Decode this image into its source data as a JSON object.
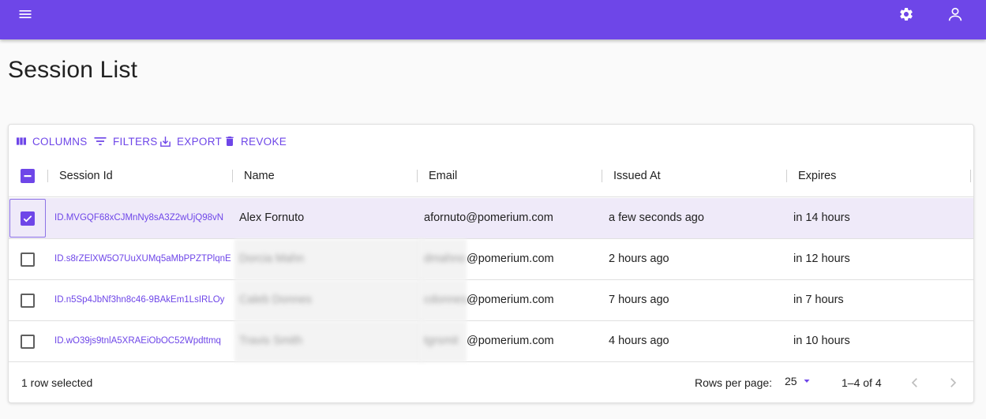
{
  "page": {
    "title": "Session List"
  },
  "toolbar": {
    "columns_label": "COLUMNS",
    "filters_label": "FILTERS",
    "export_label": "EXPORT",
    "revoke_label": "REVOKE"
  },
  "table": {
    "headers": [
      "Session Id",
      "Name",
      "Email",
      "Issued At",
      "Expires"
    ],
    "rows": [
      {
        "selected": true,
        "session_id": "ID.MVGQF68xCJMnNy8sA3Z2wUjQ98vN",
        "name": "Alex Fornuto",
        "email_user": "afornuto",
        "email_domain": "@pomerium.com",
        "email_full": "afornuto@pomerium.com",
        "issued_at": "a few seconds ago",
        "expires": "in 14 hours"
      },
      {
        "selected": false,
        "session_id": "ID.s8rZElXW5O7UuXUMq5aMbPPZTPlqnE",
        "name": "Dorcia Mahn",
        "email_user": "dmahno",
        "email_domain": "@pomerium.com",
        "issued_at": "2 hours ago",
        "expires": "in 12 hours"
      },
      {
        "selected": false,
        "session_id": "ID.n5Sp4JbNf3hn8c46-9BAkEm1LsIRLOy",
        "name": "Caleb Donnes",
        "email_user": "cdonnes",
        "email_domain": "@pomerium.com",
        "issued_at": "7 hours ago",
        "expires": "in 7 hours"
      },
      {
        "selected": false,
        "session_id": "ID.wO39js9tnlA5XRAEiObOC52Wpdttmq",
        "name": "Travis Smith",
        "email_user": "tgrsmit",
        "email_domain": "@pomerium.com",
        "issued_at": "4 hours ago",
        "expires": "in 10 hours"
      }
    ]
  },
  "footer": {
    "selection_text": "1 row selected",
    "rows_per_page_label": "Rows per page:",
    "rows_per_page_value": "25",
    "range_text": "1–4 of 4"
  },
  "icons": {
    "menu": "menu-icon",
    "settings": "gear-icon",
    "account": "user-icon"
  },
  "colors": {
    "primary": "#6e46e8",
    "selected_row": "#efeaf9"
  }
}
